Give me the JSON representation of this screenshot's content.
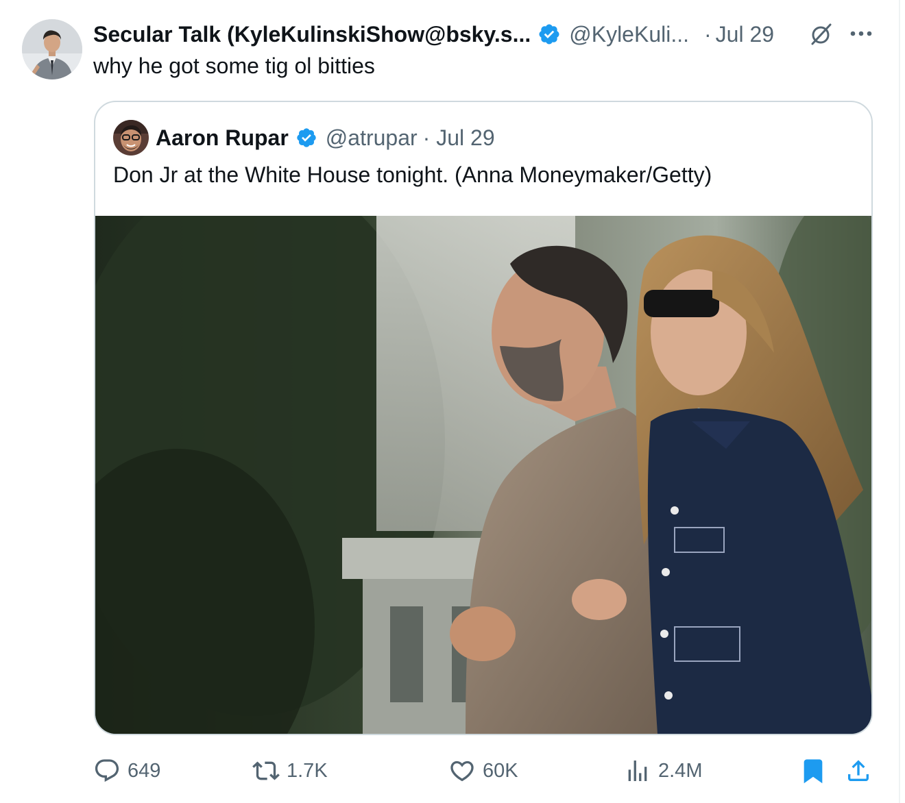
{
  "tweet": {
    "author": {
      "display_name": "Secular Talk (KyleKulinskiShow@bsky.s...",
      "handle": "@KyleKuli...",
      "verified": true,
      "avatar": "profile-photo"
    },
    "separator": "·",
    "date": "Jul 29",
    "text": "why he got some tig ol bitties",
    "icons": {
      "grok": "grok-icon",
      "more": "more-icon",
      "verified_color": "#1d9bf0"
    }
  },
  "quote": {
    "author": {
      "display_name": "Aaron Rupar",
      "handle": "@atrupar",
      "verified": true,
      "avatar": "profile-photo"
    },
    "meta": "· Jul 29",
    "text": "Don Jr at the White House tonight. (Anna Moneymaker/Getty)",
    "media": "photo"
  },
  "actions": {
    "replies": {
      "icon": "reply-icon",
      "count": "649"
    },
    "reposts": {
      "icon": "repost-icon",
      "count": "1.7K"
    },
    "likes": {
      "icon": "heart-icon",
      "count": "60K"
    },
    "views": {
      "icon": "views-icon",
      "count": "2.4M"
    },
    "bookmark": {
      "icon": "bookmark-icon",
      "color": "#1d9bf0"
    },
    "share": {
      "icon": "share-icon",
      "color": "#1d9bf0"
    }
  },
  "colors": {
    "text_primary": "#0f1419",
    "text_secondary": "#536471",
    "accent": "#1d9bf0",
    "border": "#cfd9de"
  }
}
